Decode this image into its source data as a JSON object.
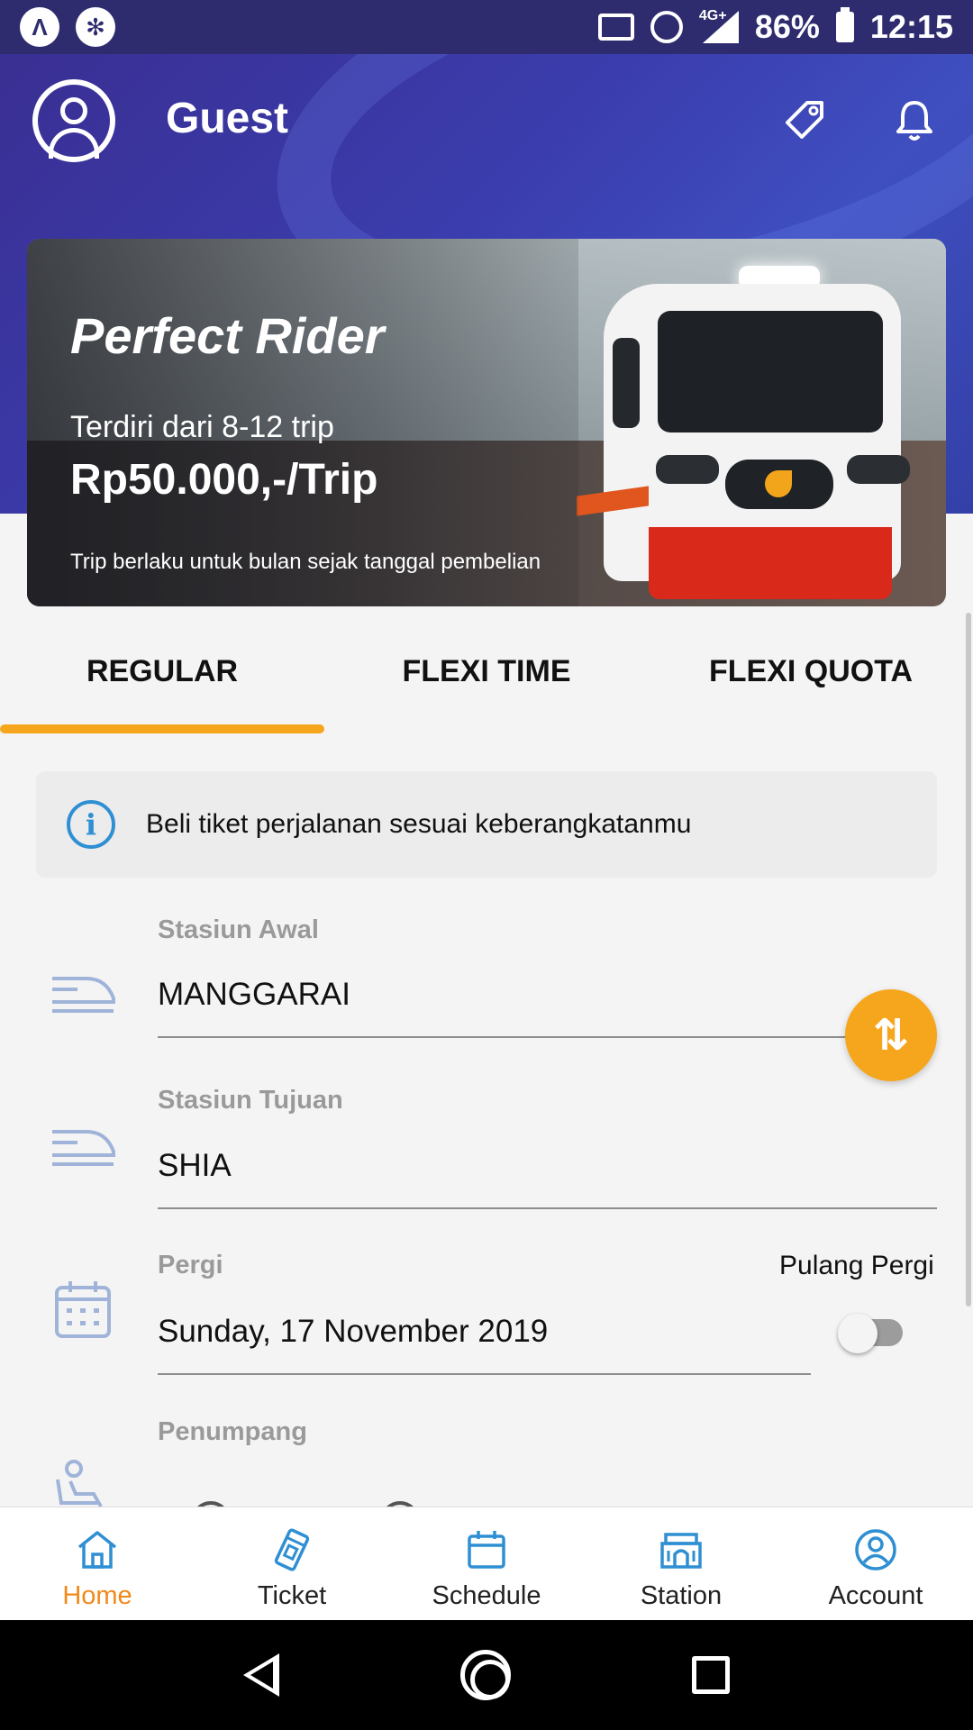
{
  "status_bar": {
    "battery": "86%",
    "time": "12:15",
    "network": "4G+",
    "icons": [
      "app-a-icon",
      "shutter-icon",
      "cast-icon",
      "alarm-icon",
      "signal-icon",
      "battery-icon"
    ]
  },
  "header": {
    "user_name": "Guest",
    "icons": [
      "avatar-icon",
      "tag-icon",
      "bell-icon"
    ]
  },
  "banner": {
    "title": "Perfect Rider",
    "subtitle": "Terdiri dari 8-12 trip",
    "price": "Rp50.000,-/Trip",
    "note": "Trip berlaku untuk bulan sejak tanggal pembelian"
  },
  "tabs": [
    {
      "label": "REGULAR",
      "active": true
    },
    {
      "label": "FLEXI TIME",
      "active": false
    },
    {
      "label": "FLEXI QUOTA",
      "active": false
    }
  ],
  "info": {
    "text": "Beli tiket perjalanan sesuai keberangkatanmu"
  },
  "form": {
    "origin": {
      "label": "Stasiun Awal",
      "value": "MANGGARAI"
    },
    "destination": {
      "label": "Stasiun Tujuan",
      "value": "SHIA"
    },
    "departure": {
      "label": "Pergi",
      "value": "Sunday, 17 November 2019"
    },
    "round_trip": {
      "label": "Pulang Pergi",
      "enabled": false
    },
    "passenger": {
      "label": "Penumpang"
    }
  },
  "bottom_nav": [
    {
      "label": "Home",
      "icon": "home-icon",
      "active": true
    },
    {
      "label": "Ticket",
      "icon": "ticket-icon",
      "active": false
    },
    {
      "label": "Schedule",
      "icon": "calendar-icon",
      "active": false
    },
    {
      "label": "Station",
      "icon": "station-icon",
      "active": false
    },
    {
      "label": "Account",
      "icon": "account-icon",
      "active": false
    }
  ],
  "colors": {
    "header": "#3b3dae",
    "accent": "#f6a61c",
    "active_nav": "#f08a1a",
    "icon_blue": "#2f8fd3",
    "icon_light": "#9fb4d8"
  }
}
